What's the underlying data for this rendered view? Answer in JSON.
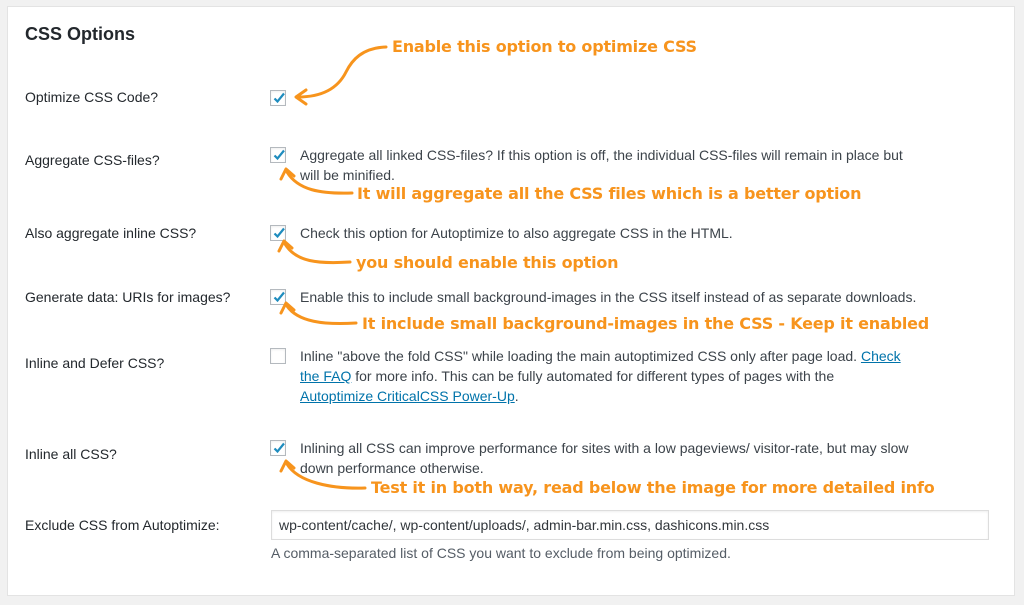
{
  "section": {
    "title": "CSS Options"
  },
  "rows": [
    {
      "label": "Optimize CSS Code?",
      "checked": true,
      "description": ""
    },
    {
      "label": "Aggregate CSS-files?",
      "checked": true,
      "description_line1": "Aggregate all linked CSS-files? If this option is off, the individual CSS-files will remain in place but",
      "description_line2": "will be minified."
    },
    {
      "label": "Also aggregate inline CSS?",
      "checked": true,
      "description_line1": "Check this option for Autoptimize to also aggregate CSS in the HTML."
    },
    {
      "label": "Generate data: URIs for images?",
      "checked": true,
      "description_line1": "Enable this to include small background-images in the CSS itself instead of as separate downloads."
    },
    {
      "label": "Inline and Defer CSS?",
      "checked": false,
      "description_text1": "Inline \"above the fold CSS\" while loading the main autoptimized CSS only after page load.",
      "link1": "Check",
      "link1b": "the FAQ",
      "description_text2": "for more info. This can be fully automated for different types of pages with the",
      "link2": "Autoptimize CriticalCSS Power-Up",
      "description_text3": "."
    },
    {
      "label": "Inline all CSS?",
      "checked": true,
      "description_line1": "Inlining all CSS can improve performance for sites with a low pageviews/ visitor-rate, but may slow",
      "description_line2": "down performance otherwise."
    },
    {
      "label": "Exclude CSS from Autoptimize:",
      "input_value": "wp-content/cache/, wp-content/uploads/, admin-bar.min.css, dashicons.min.css",
      "help": "A comma-separated list of CSS you want to exclude from being optimized."
    }
  ],
  "annotations": [
    "Enable this option to optimize CSS",
    "It will aggregate all the CSS files which is a better option",
    "you should enable this option",
    "It include small background-images in the CSS  - Keep it enabled",
    "Test it in both way, read below the image for more detailed info"
  ],
  "colors": {
    "accent": "#f7941d",
    "link": "#0073aa",
    "check": "#1e8cbe"
  }
}
